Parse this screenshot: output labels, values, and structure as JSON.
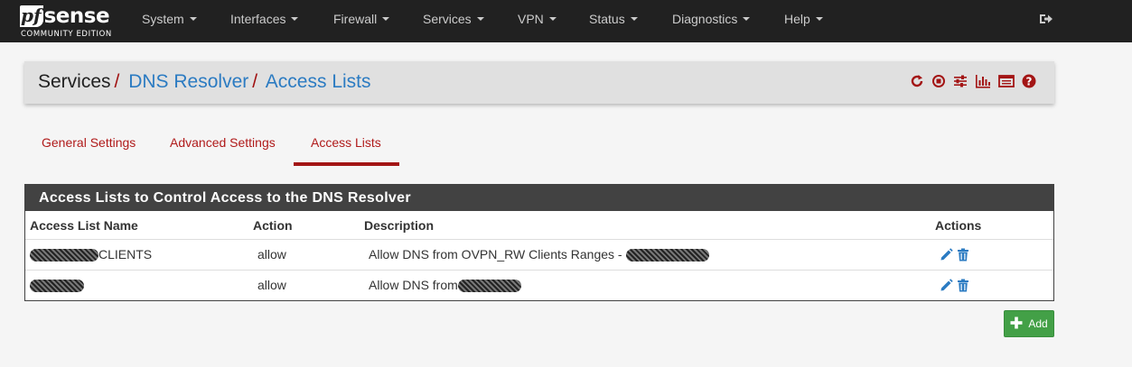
{
  "brand": {
    "name_pf": "pf",
    "name_sense": "sense",
    "subtitle": "COMMUNITY EDITION"
  },
  "nav": {
    "items": [
      {
        "label": "System"
      },
      {
        "label": "Interfaces"
      },
      {
        "label": "Firewall"
      },
      {
        "label": "Services"
      },
      {
        "label": "VPN"
      },
      {
        "label": "Status"
      },
      {
        "label": "Diagnostics"
      },
      {
        "label": "Help"
      }
    ],
    "logout_icon": "sign-out-icon"
  },
  "breadcrumb": {
    "items": [
      "Services",
      "DNS Resolver",
      "Access Lists"
    ],
    "separator": "/",
    "icons": [
      "restart-service-icon",
      "stop-service-icon",
      "related-settings-icon",
      "status-graph-icon",
      "log-icon",
      "help-icon"
    ]
  },
  "tabs": [
    {
      "label": "General Settings",
      "active": false
    },
    {
      "label": "Advanced Settings",
      "active": false
    },
    {
      "label": "Access Lists",
      "active": true
    }
  ],
  "panel": {
    "title": "Access Lists to Control Access to the DNS Resolver",
    "columns": [
      "Access List Name",
      "Action",
      "Description",
      "Actions"
    ],
    "rows": [
      {
        "name": "CLIENTS",
        "action": "allow",
        "description": "Allow DNS from OVPN_RW Clients Ranges -"
      },
      {
        "name": "",
        "action": "allow",
        "description": "Allow DNS from"
      }
    ]
  },
  "add_button": {
    "label": "Add"
  },
  "colors": {
    "navbar": "#212121",
    "accent_red": "#b01a1a",
    "link_blue": "#2b7bc2",
    "add_green": "#43a047"
  }
}
